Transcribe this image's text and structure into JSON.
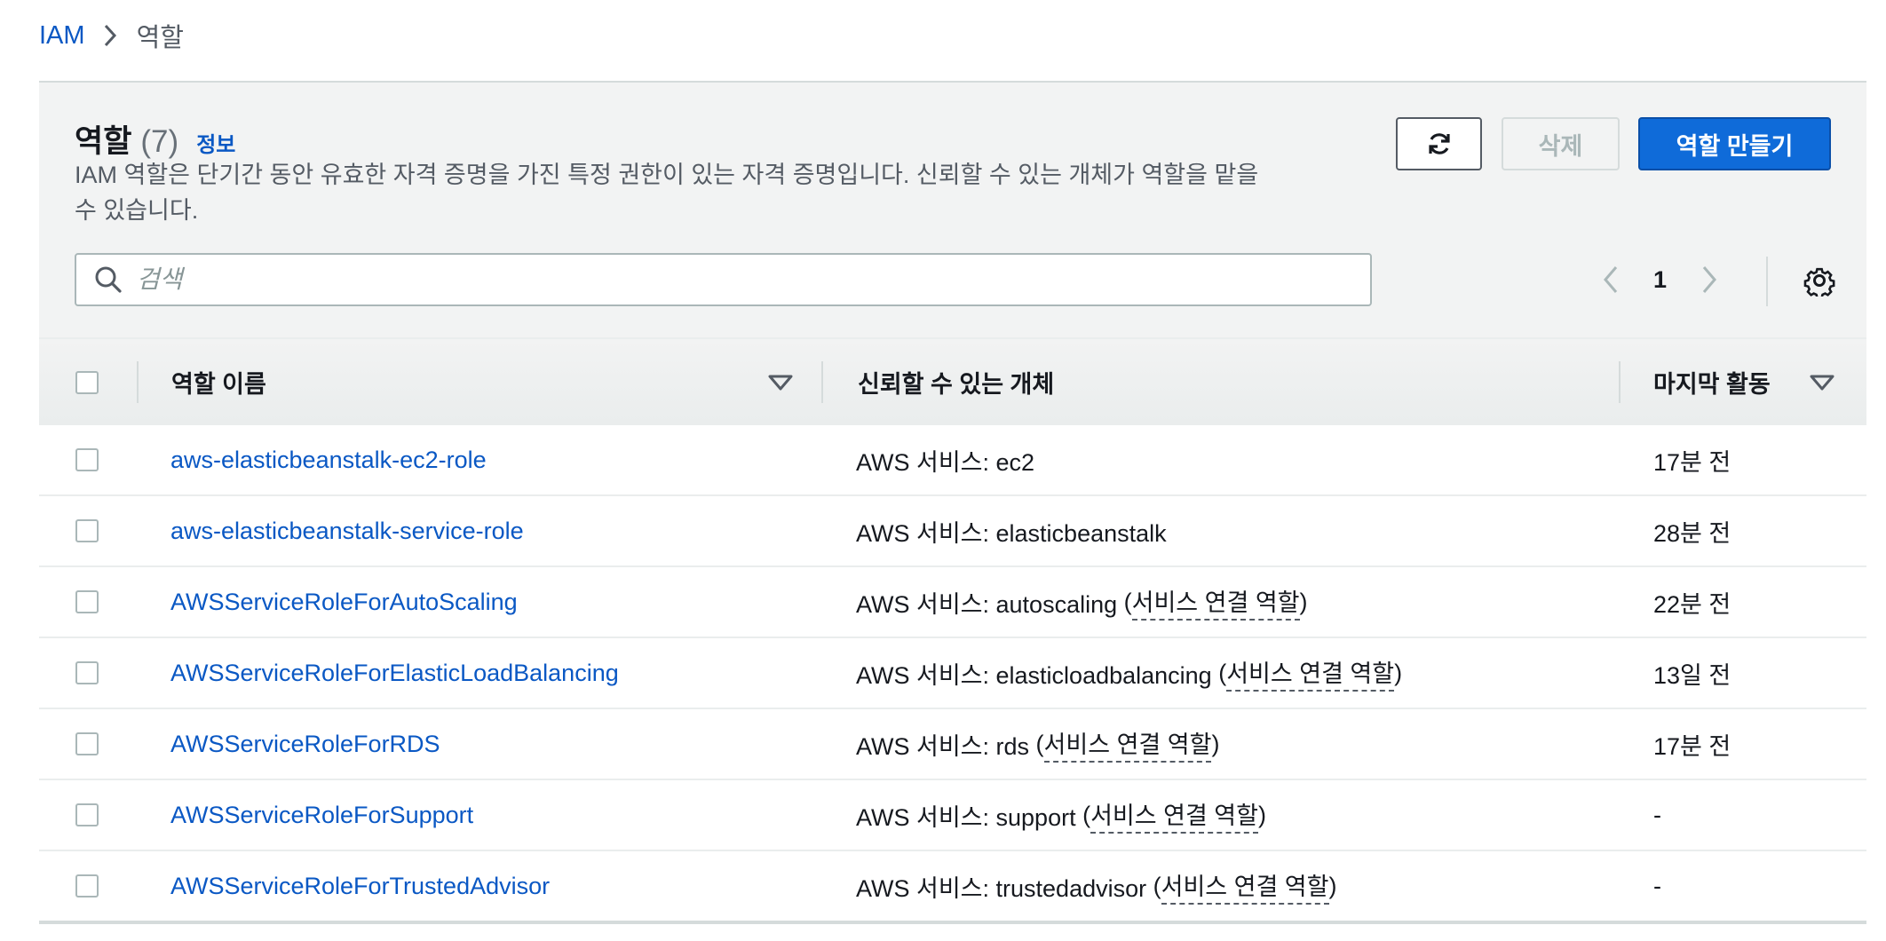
{
  "breadcrumb": {
    "root": "IAM",
    "current": "역할"
  },
  "header": {
    "title": "역할",
    "count": "(7)",
    "info": "정보",
    "description": "IAM 역할은 단기간 동안 유효한 자격 증명을 가진 특정 권한이 있는 자격 증명입니다. 신뢰할 수 있는 개체가 역할을 맡을 수 있습니다."
  },
  "buttons": {
    "delete": "삭제",
    "create": "역할 만들기"
  },
  "search": {
    "placeholder": "검색",
    "value": ""
  },
  "pagination": {
    "page": "1"
  },
  "table": {
    "columns": {
      "name": "역할 이름",
      "trusted": "신뢰할 수 있는 개체",
      "last_activity": "마지막 활동"
    },
    "rows": [
      {
        "name": "aws-elasticbeanstalk-ec2-role",
        "trust_prefix": "AWS 서비스: ec2",
        "trust_paren_open": "",
        "trust_link": "",
        "trust_paren_close": "",
        "last": "17분 전"
      },
      {
        "name": "aws-elasticbeanstalk-service-role",
        "trust_prefix": "AWS 서비스: elasticbeanstalk",
        "trust_paren_open": "",
        "trust_link": "",
        "trust_paren_close": "",
        "last": "28분 전"
      },
      {
        "name": "AWSServiceRoleForAutoScaling",
        "trust_prefix": "AWS 서비스: autoscaling ",
        "trust_paren_open": "(",
        "trust_link": "서비스 연결 역할",
        "trust_paren_close": ")",
        "last": "22분 전"
      },
      {
        "name": "AWSServiceRoleForElasticLoadBalancing",
        "trust_prefix": "AWS 서비스: elasticloadbalancing ",
        "trust_paren_open": "(",
        "trust_link": "서비스 연결 역할",
        "trust_paren_close": ")",
        "last": "13일 전"
      },
      {
        "name": "AWSServiceRoleForRDS",
        "trust_prefix": "AWS 서비스: rds ",
        "trust_paren_open": "(",
        "trust_link": "서비스 연결 역할",
        "trust_paren_close": ")",
        "last": "17분 전"
      },
      {
        "name": "AWSServiceRoleForSupport",
        "trust_prefix": "AWS 서비스: support ",
        "trust_paren_open": "(",
        "trust_link": "서비스 연결 역할",
        "trust_paren_close": ")",
        "last": "-"
      },
      {
        "name": "AWSServiceRoleForTrustedAdvisor",
        "trust_prefix": "AWS 서비스: trustedadvisor ",
        "trust_paren_open": "(",
        "trust_link": "서비스 연결 역할",
        "trust_paren_close": ")",
        "last": "-"
      }
    ]
  },
  "colors": {
    "link": "#0a58c4",
    "primary": "#0f6bd9",
    "header_bg": "#f2f3f3"
  },
  "icons": {
    "breadcrumb_sep": "chevron-right-icon",
    "refresh": "refresh-icon",
    "search": "search-icon",
    "prev": "chevron-left-icon",
    "next": "chevron-right-icon",
    "settings": "gear-icon",
    "sort": "sort-down-icon"
  }
}
